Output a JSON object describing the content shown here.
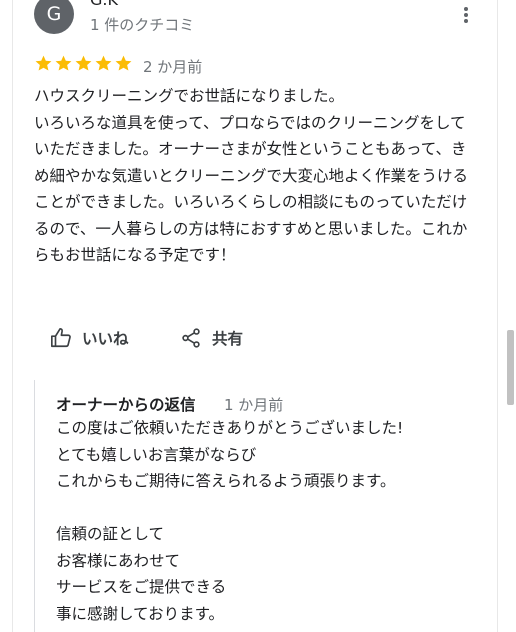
{
  "reviewer": {
    "avatar_letter": "G",
    "name": "G.K",
    "review_count": "1 件のクチコミ"
  },
  "rating": {
    "stars": 5,
    "max_stars": 5,
    "color": "#fbbc04",
    "time": "2 か月前"
  },
  "review_text": "ハウスクリーニングでお世話になりました。\nいろいろな道具を使って、プロならではのクリーニングをしていただきました。オーナーさまが女性ということもあって、きめ細やかな気遣いとクリーニングで大変心地よく作業をうけることができました。いろいろくらしの相談にものっていただけるので、一人暮らしの方は特におすすめと思いました。これからもお世話になる予定です！",
  "actions": {
    "like_label": "いいね",
    "share_label": "共有"
  },
  "owner_reply": {
    "title": "オーナーからの返信",
    "time": "1 か月前",
    "text": "この度はご依頼いただきありがとうございました!\nとても嬉しいお言葉がならび\nこれからもご期待に答えられるよう頑張ります。\n\n信頼の証として\nお客様にあわせて\nサービスをご提供できる\n事に感謝しております。"
  },
  "icons": {
    "more": "more-vert-icon",
    "like": "thumb-up-icon",
    "share": "share-icon",
    "star": "star-icon"
  }
}
